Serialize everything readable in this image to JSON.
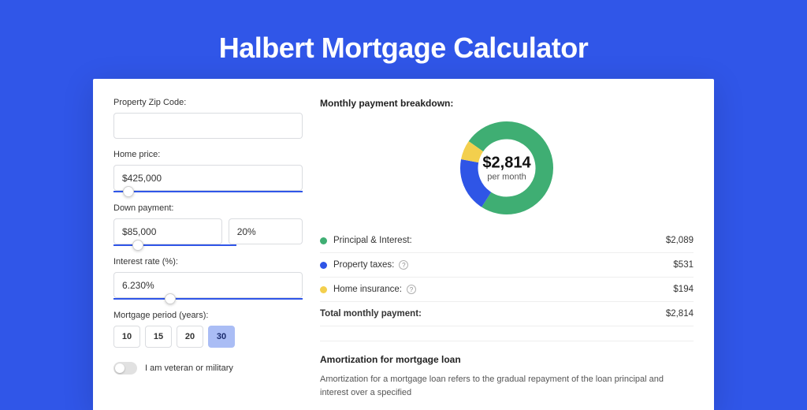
{
  "title": "Halbert Mortgage Calculator",
  "left": {
    "zip_label": "Property Zip Code:",
    "zip_value": "",
    "home_price_label": "Home price:",
    "home_price_value": "$425,000",
    "home_price_slider_pct": 8,
    "down_payment_label": "Down payment:",
    "down_payment_value": "$85,000",
    "down_payment_pct_value": "20%",
    "down_payment_slider_pct": 20,
    "interest_label": "Interest rate (%):",
    "interest_value": "6.230%",
    "interest_slider_pct": 30,
    "period_label": "Mortgage period (years):",
    "periods": [
      "10",
      "15",
      "20",
      "30"
    ],
    "period_selected_index": 3,
    "veteran_label": "I am veteran or military",
    "veteran_on": false
  },
  "right": {
    "breakdown_title": "Monthly payment breakdown:",
    "center_amount": "$2,814",
    "center_sub": "per month",
    "items": [
      {
        "label": "Principal & Interest:",
        "value": "$2,089",
        "color": "#3fae73",
        "help": false
      },
      {
        "label": "Property taxes:",
        "value": "$531",
        "color": "#2f55e6",
        "help": true
      },
      {
        "label": "Home insurance:",
        "value": "$194",
        "color": "#f3cf4d",
        "help": true
      }
    ],
    "total_label": "Total monthly payment:",
    "total_value": "$2,814",
    "amort_title": "Amortization for mortgage loan",
    "amort_text": "Amortization for a mortgage loan refers to the gradual repayment of the loan principal and interest over a specified"
  },
  "chart_data": {
    "type": "pie",
    "title": "Monthly payment breakdown",
    "series": [
      {
        "name": "Principal & Interest",
        "value": 2089,
        "color": "#3fae73"
      },
      {
        "name": "Property taxes",
        "value": 531,
        "color": "#2f55e6"
      },
      {
        "name": "Home insurance",
        "value": 194,
        "color": "#f3cf4d"
      }
    ],
    "total": 2814,
    "unit": "USD per month"
  }
}
